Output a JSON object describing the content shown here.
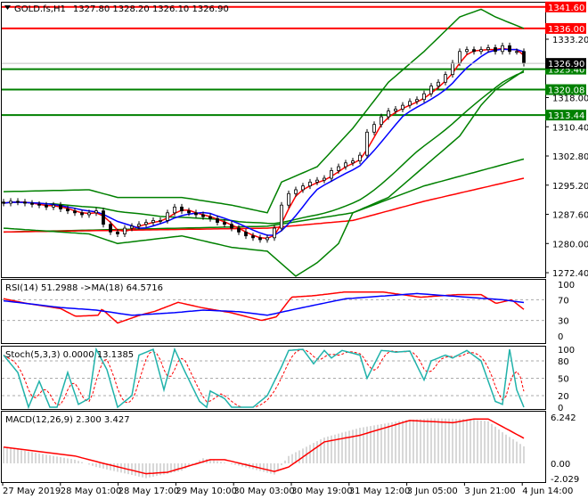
{
  "header": {
    "symbol": "GOLD.fs,H1",
    "ohlc": "1327.80 1328.20 1326.10 1326.90"
  },
  "chart_data": {
    "type": "candlestick",
    "title": "GOLD.fs,H1",
    "ylim": [
      1270.5,
      1343
    ],
    "y_ticks": [
      "1333.20",
      "1318.00",
      "1310.40",
      "1302.80",
      "1295.20",
      "1287.60",
      "1280.00",
      "1272.40"
    ],
    "current_price": "1326.90",
    "levels": [
      {
        "value": 1341.6,
        "label": "1341.60",
        "color": "#ff0000"
      },
      {
        "value": 1336.0,
        "label": "1336.00",
        "color": "#ff0000"
      },
      {
        "value": 1325.4,
        "label": "1325.40",
        "color": "#008000"
      },
      {
        "value": 1320.08,
        "label": "1320.08",
        "color": "#008000"
      },
      {
        "value": 1313.44,
        "label": "1313.44",
        "color": "#008000"
      }
    ],
    "x_labels": [
      "27 May 2019",
      "28 May 01:00",
      "28 May 17:00",
      "29 May 10:00",
      "30 May 03:00",
      "30 May 19:00",
      "31 May 12:00",
      "3 Jun 05:00",
      "3 Jun 21:00",
      "4 Jun 14:00"
    ],
    "closes": [
      1290.5,
      1291,
      1290.8,
      1290.5,
      1290.2,
      1290,
      1289.5,
      1290,
      1289,
      1288.5,
      1288,
      1287.5,
      1288,
      1288.5,
      1285,
      1283,
      1282.5,
      1284,
      1284.5,
      1285,
      1285.5,
      1286,
      1286,
      1288,
      1289.5,
      1288.5,
      1288,
      1287.5,
      1287,
      1286.5,
      1285.5,
      1285,
      1284,
      1283,
      1282,
      1281.5,
      1281,
      1281.5,
      1284,
      1290,
      1293,
      1294,
      1295,
      1296,
      1296.5,
      1297,
      1299,
      1300,
      1301,
      1301.5,
      1303,
      1309,
      1311,
      1313,
      1314.5,
      1315,
      1316,
      1317,
      1317.5,
      1319,
      1321,
      1322,
      1324,
      1327,
      1330,
      1330.5,
      1330,
      1330.5,
      1331,
      1330,
      1331.5,
      1330,
      1330,
      1326.9
    ],
    "bollinger_upper": [
      [
        0,
        1293.5
      ],
      [
        12,
        1294
      ],
      [
        16,
        1292
      ],
      [
        25,
        1292
      ],
      [
        32,
        1290
      ],
      [
        37,
        1288
      ],
      [
        39,
        1296
      ],
      [
        44,
        1300
      ],
      [
        49,
        1310
      ],
      [
        54,
        1322
      ],
      [
        59,
        1330
      ],
      [
        64,
        1339
      ],
      [
        67,
        1341
      ],
      [
        69,
        1339
      ],
      [
        73,
        1336
      ]
    ],
    "bollinger_lower": [
      [
        0,
        1284
      ],
      [
        12,
        1282.5
      ],
      [
        16,
        1280
      ],
      [
        25,
        1282
      ],
      [
        32,
        1279
      ],
      [
        37,
        1278
      ],
      [
        41,
        1271.5
      ],
      [
        44,
        1275
      ],
      [
        47,
        1280
      ],
      [
        49,
        1288
      ],
      [
        54,
        1292
      ],
      [
        59,
        1300
      ],
      [
        64,
        1308
      ],
      [
        67,
        1316
      ],
      [
        69,
        1320
      ],
      [
        73,
        1325
      ]
    ],
    "ma_long_green": [
      [
        0,
        1283
      ],
      [
        37,
        1284.5
      ],
      [
        49,
        1288
      ],
      [
        59,
        1295
      ],
      [
        73,
        1302
      ]
    ],
    "ma_long_red": [
      [
        0,
        1283
      ],
      [
        37,
        1284
      ],
      [
        49,
        1286
      ],
      [
        59,
        1291
      ],
      [
        73,
        1297
      ]
    ],
    "rsi": {
      "label": "RSI(14) 51.2988  ->MA(18) 64.5716",
      "ticks": [
        "100",
        "70",
        "30",
        "0"
      ],
      "values": [
        [
          0,
          72
        ],
        [
          3.2,
          63
        ],
        [
          8,
          53
        ],
        [
          10.1,
          38
        ],
        [
          13.3,
          40
        ],
        [
          13.8,
          52
        ],
        [
          16,
          25
        ],
        [
          19.1,
          40
        ],
        [
          21.3,
          48
        ],
        [
          24.5,
          65
        ],
        [
          27.7,
          55
        ],
        [
          31.9,
          45
        ],
        [
          36.2,
          30
        ],
        [
          38.3,
          37
        ],
        [
          40.4,
          75
        ],
        [
          43.6,
          78
        ],
        [
          47.9,
          85
        ],
        [
          53.2,
          85
        ],
        [
          58.5,
          75
        ],
        [
          63.8,
          80
        ],
        [
          67,
          80
        ],
        [
          69.1,
          63
        ],
        [
          71.3,
          70
        ],
        [
          73,
          51.3
        ]
      ],
      "ma": [
        [
          0,
          68
        ],
        [
          8,
          55
        ],
        [
          13,
          50
        ],
        [
          18,
          40
        ],
        [
          24,
          45
        ],
        [
          28,
          50
        ],
        [
          33,
          47
        ],
        [
          37,
          40
        ],
        [
          42,
          55
        ],
        [
          48,
          72
        ],
        [
          58,
          82
        ],
        [
          70,
          70
        ],
        [
          73,
          64.6
        ]
      ]
    },
    "stoch": {
      "label": "Stoch(5,3,3) 0.0000 13.1385",
      "ticks": [
        "100",
        "80",
        "50",
        "20",
        "0"
      ],
      "values": [
        [
          0,
          90
        ],
        [
          2,
          60
        ],
        [
          3.5,
          0
        ],
        [
          5,
          45
        ],
        [
          6.5,
          0
        ],
        [
          7.5,
          0
        ],
        [
          9,
          60
        ],
        [
          10.5,
          5
        ],
        [
          12,
          15
        ],
        [
          13,
          100
        ],
        [
          14.5,
          65
        ],
        [
          16,
          0
        ],
        [
          18,
          20
        ],
        [
          19,
          90
        ],
        [
          21,
          100
        ],
        [
          22.5,
          30
        ],
        [
          24,
          100
        ],
        [
          25.5,
          60
        ],
        [
          27.5,
          10
        ],
        [
          28.5,
          0
        ],
        [
          29,
          28
        ],
        [
          31,
          15
        ],
        [
          32,
          0
        ],
        [
          35,
          0
        ],
        [
          37,
          20
        ],
        [
          39,
          70
        ],
        [
          40,
          98
        ],
        [
          42,
          100
        ],
        [
          43.5,
          75
        ],
        [
          45,
          98
        ],
        [
          46,
          85
        ],
        [
          47.5,
          98
        ],
        [
          50,
          90
        ],
        [
          51,
          50
        ],
        [
          53,
          98
        ],
        [
          54,
          97
        ],
        [
          55,
          95
        ],
        [
          57,
          97
        ],
        [
          59,
          47
        ],
        [
          60,
          80
        ],
        [
          62,
          90
        ],
        [
          63,
          85
        ],
        [
          65,
          98
        ],
        [
          67,
          80
        ],
        [
          69,
          10
        ],
        [
          70,
          5
        ],
        [
          71,
          100
        ],
        [
          72,
          30
        ],
        [
          73,
          0
        ]
      ]
    },
    "macd": {
      "label": "MACD(12,26,9) 2.300 3.427",
      "ticks": [
        "6.242",
        "0.00",
        "-2.029"
      ],
      "histogram": [
        [
          0,
          2.2
        ],
        [
          10,
          0.5
        ],
        [
          13,
          -0.5
        ],
        [
          20,
          -2.0
        ],
        [
          25,
          -1.0
        ],
        [
          28,
          0.7
        ],
        [
          33,
          -0.3
        ],
        [
          38,
          -1.5
        ],
        [
          40,
          1.0
        ],
        [
          45,
          3.5
        ],
        [
          50,
          4.8
        ],
        [
          56,
          5.8
        ],
        [
          60,
          6.1
        ],
        [
          65,
          6.0
        ],
        [
          68,
          5.7
        ],
        [
          70,
          4.2
        ],
        [
          73,
          2.3
        ]
      ],
      "signal": [
        [
          0,
          2.2
        ],
        [
          10,
          1
        ],
        [
          14,
          0
        ],
        [
          20,
          -1.4
        ],
        [
          23,
          -1.2
        ],
        [
          29,
          0.5
        ],
        [
          31,
          0.5
        ],
        [
          38,
          -1.1
        ],
        [
          40,
          -0.5
        ],
        [
          45,
          2.9
        ],
        [
          50,
          3.8
        ],
        [
          57,
          5.8
        ],
        [
          63,
          5.5
        ],
        [
          66,
          6.0
        ],
        [
          68,
          6.0
        ],
        [
          73,
          3.4
        ]
      ]
    }
  }
}
